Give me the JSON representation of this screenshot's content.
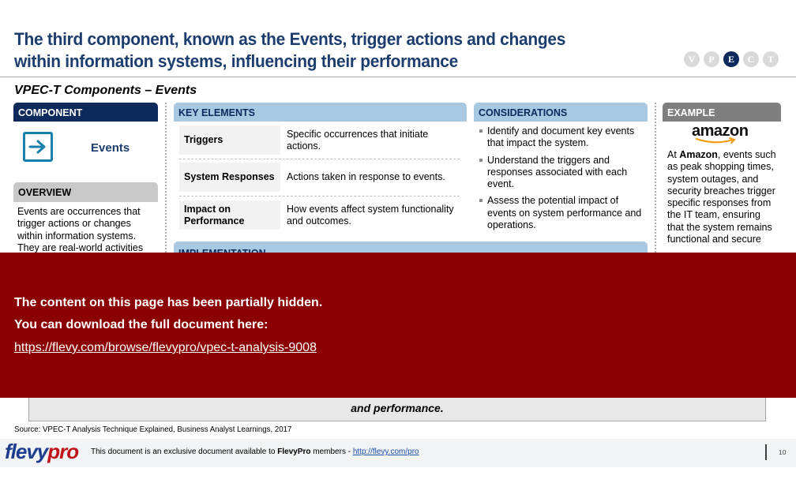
{
  "header": {
    "title": "The third component, known as the Events, trigger actions and changes within information systems, influencing their performance",
    "nav": [
      {
        "letter": "V",
        "active": false
      },
      {
        "letter": "P",
        "active": false
      },
      {
        "letter": "E",
        "active": true
      },
      {
        "letter": "C",
        "active": false
      },
      {
        "letter": "T",
        "active": false
      }
    ]
  },
  "subtitle": "VPEC-T Components – Events",
  "component": {
    "header": "COMPONENT",
    "icon": "arrow-right-square-icon",
    "label": "Events",
    "overview_header": "OVERVIEW",
    "overview_text": "Events are occurrences that trigger actions or changes within information systems. They are real-world activities"
  },
  "key_elements": {
    "header": "KEY ELEMENTS",
    "rows": [
      {
        "name": "Triggers",
        "desc": "Specific occurrences that initiate actions."
      },
      {
        "name": "System Responses",
        "desc": "Actions taken in response to events."
      },
      {
        "name": "Impact on Performance",
        "desc": "How events affect system functionality and outcomes."
      }
    ]
  },
  "considerations": {
    "header": "CONSIDERATIONS",
    "items": [
      "Identify and document key events that impact the system.",
      "Understand the triggers and responses associated with each event.",
      "Assess the potential impact of events on system performance and operations."
    ]
  },
  "example": {
    "header": "EXAMPLE",
    "logo_text": "amazon",
    "text_bold": "Amazon",
    "text_prefix": "At ",
    "text_rest": ", events such as peak shopping times, system outages, and security breaches trigger specific responses from the IT team, ensuring that the system remains functional and secure"
  },
  "implementation": {
    "header": "IMPLEMENTATION"
  },
  "bottom_box": {
    "text": "and performance."
  },
  "overlay": {
    "line1": "The content on this page has been partially hidden.",
    "line2": "You can download the full document here:",
    "link": "https://flevy.com/browse/flevypro/vpec-t-analysis-9008"
  },
  "source": "Source: VPEC-T Analysis Technique Explained, Business Analyst Learnings, 2017",
  "footer": {
    "logo_part1": "flevy",
    "logo_part2": "pro",
    "text_prefix": "This document is an exclusive document available to ",
    "text_brand": "FlevyPro",
    "text_suffix": " members - ",
    "link": "http://flevy.com/pro",
    "page_number": "10"
  }
}
